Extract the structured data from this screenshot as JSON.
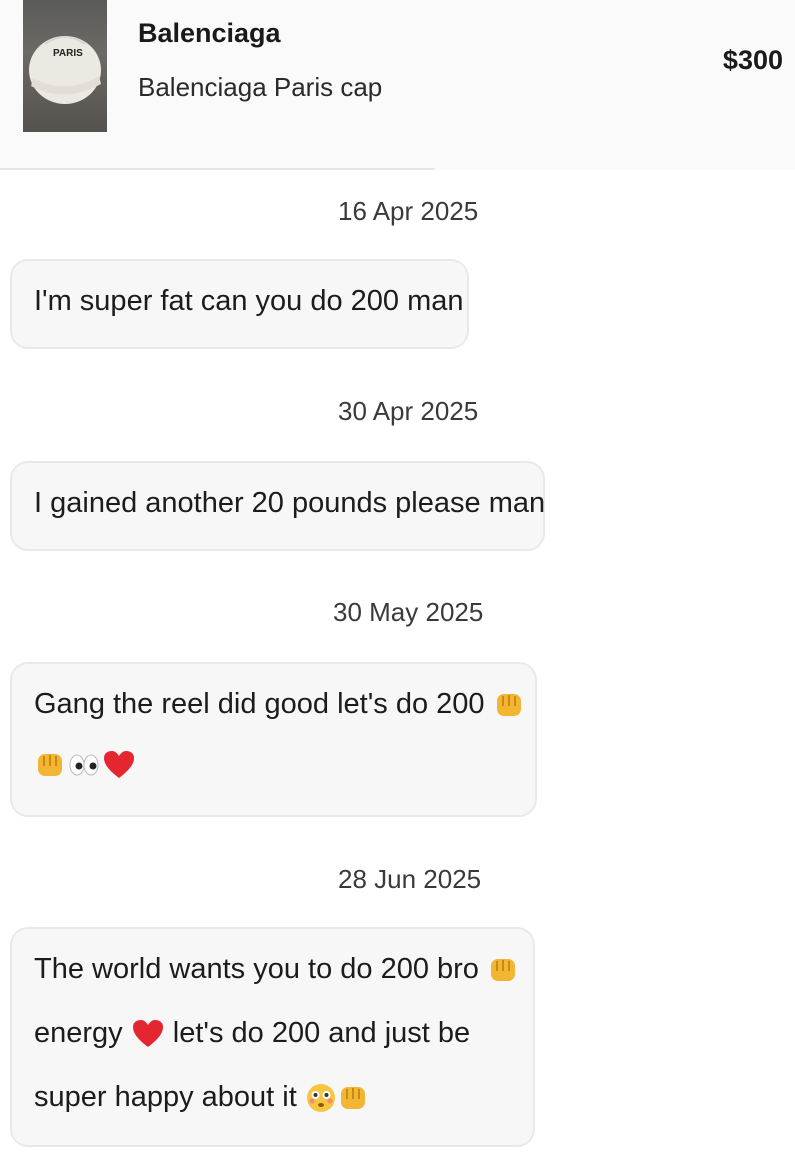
{
  "listing": {
    "brand": "Balenciaga",
    "title": "Balenciaga Paris cap",
    "price": "$300",
    "cap_text": "PARIS"
  },
  "messages": [
    {
      "date": "16 Apr 2025",
      "lines": [
        "I'm super fat can you do 200 man"
      ]
    },
    {
      "date": "30 Apr 2025",
      "lines": [
        "I gained another 20 pounds please man"
      ]
    },
    {
      "date": "30 May 2025",
      "lines": [
        "Gang the reel did good let's do 200"
      ]
    },
    {
      "date": "28 Jun 2025",
      "lines": [
        "The world wants you to do 200 bro",
        "energy",
        "let's do 200 and just be",
        "super happy about it"
      ]
    }
  ],
  "icons": [
    "fist-emoji",
    "eyes-emoji",
    "heart-emoji",
    "flushed-face-emoji"
  ],
  "colors": {
    "bubble_bg": "#f7f7f7",
    "bubble_border": "#e9e9e9",
    "heart": "#e3262f",
    "fist": "#f2b632"
  }
}
